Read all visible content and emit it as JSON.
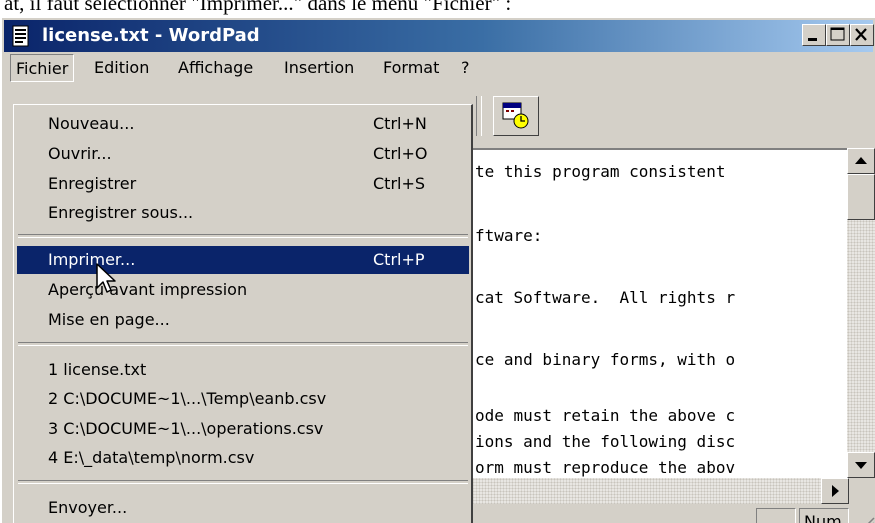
{
  "caption": {
    "text": "at, il faut sélectionner \"Imprimer...\" dans le menu \"Fichier\" :"
  },
  "window": {
    "title": "license.txt - WordPad"
  },
  "titlebar_buttons": [
    {
      "name": "minimize-button",
      "icon": "minimize-icon"
    },
    {
      "name": "maximize-button",
      "icon": "maximize-icon"
    },
    {
      "name": "close-button",
      "icon": "close-icon"
    }
  ],
  "menubar": {
    "items": [
      "Fichier",
      "Edition",
      "Affichage",
      "Insertion",
      "Format",
      "?"
    ],
    "active": "Fichier"
  },
  "toolbar": {
    "visible_button_icon": "date-time-icon"
  },
  "file_menu": {
    "items": [
      {
        "label": "Nouveau...",
        "shortcut": "Ctrl+N"
      },
      {
        "label": "Ouvrir...",
        "shortcut": "Ctrl+O"
      },
      {
        "label": "Enregistrer",
        "shortcut": "Ctrl+S"
      },
      {
        "label": "Enregistrer sous...",
        "shortcut": ""
      },
      {
        "label": "Imprimer...",
        "shortcut": "Ctrl+P"
      },
      {
        "label": "Aperçu avant impression",
        "shortcut": ""
      },
      {
        "label": "Mise en page...",
        "shortcut": ""
      },
      {
        "label": "1 license.txt",
        "shortcut": ""
      },
      {
        "label": "2 C:\\DOCUME~1\\...\\Temp\\eanb.csv",
        "shortcut": ""
      },
      {
        "label": "3 C:\\DOCUME~1\\...\\operations.csv",
        "shortcut": ""
      },
      {
        "label": "4 E:\\_data\\temp\\norm.csv",
        "shortcut": ""
      },
      {
        "label": "Envoyer...",
        "shortcut": ""
      }
    ],
    "highlighted": "Imprimer..."
  },
  "document": {
    "lines": [
      "te this program consistent",
      "",
      "ftware:",
      "",
      "cat Software.  All rights r",
      "",
      "ce and binary forms, with o",
      "",
      "ode must retain the above c",
      "ions and the following disc",
      "orm must reproduce the abov"
    ]
  },
  "statusbar": {
    "panels": [
      "",
      "Num"
    ]
  },
  "colors": {
    "title_gradient_start": "#0a246a",
    "title_gradient_end": "#a6caf0",
    "face": "#d4d0c8",
    "highlight": "#0a246a"
  }
}
